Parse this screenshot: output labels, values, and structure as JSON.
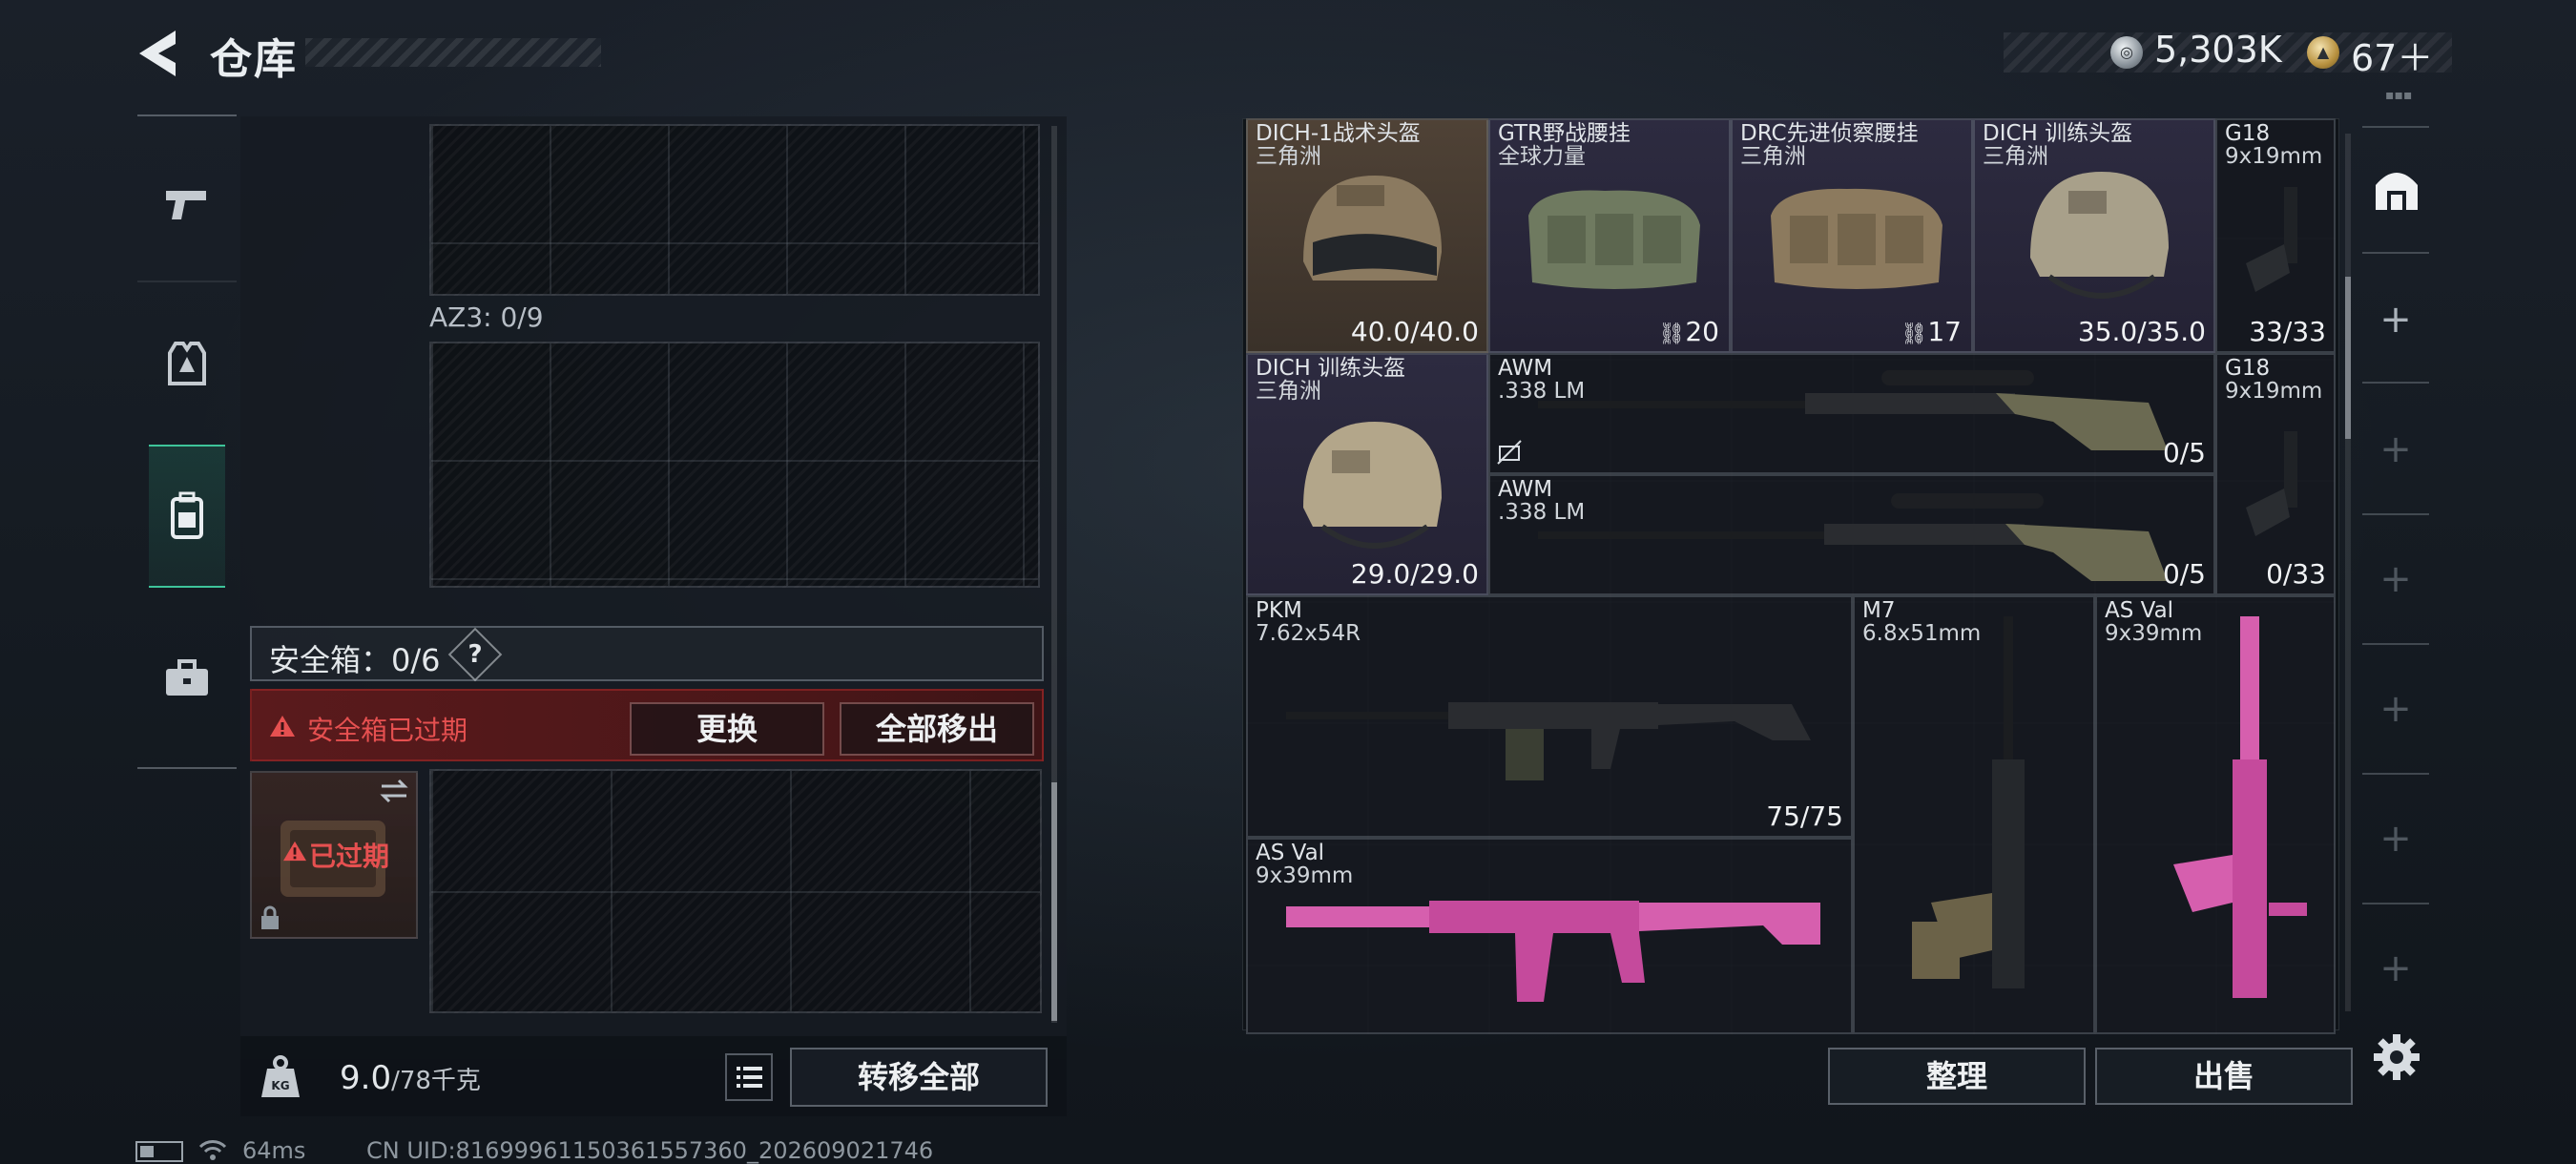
{
  "header": {
    "title": "仓库",
    "silver_value": "5,303K",
    "gold_value": "67＋",
    "corner_mark": "▪▪▪"
  },
  "left_nav": {
    "tabs": [
      {
        "name": "weapons",
        "icon": "pistol-icon"
      },
      {
        "name": "equipment",
        "icon": "vest-icon"
      },
      {
        "name": "backpack",
        "icon": "backpack-icon",
        "active": true
      },
      {
        "name": "briefcase",
        "icon": "briefcase-icon"
      }
    ]
  },
  "left_panel": {
    "az3_label": "AZ3: 0/9",
    "safe_box_label": "安全箱：0/6",
    "safe_help": "?",
    "expired_message": "安全箱已过期",
    "replace_button": "更换",
    "move_all_out_button": "全部移出",
    "case_expired": "已过期"
  },
  "weight": {
    "current": "9.0",
    "max": "/78千克",
    "transfer_all_button": "转移全部"
  },
  "status": {
    "ping": "64ms",
    "uid": "CN UID:8169996115036155736​0_202609021746"
  },
  "warehouse": {
    "items": [
      {
        "name": "DICH-1战术头盔",
        "sub": "三角洲",
        "value": "40.0/40.0"
      },
      {
        "name": "GTR野战腰挂",
        "sub": "全球力量",
        "value": "20"
      },
      {
        "name": "DRC先进侦察腰挂",
        "sub": "三角洲",
        "value": "17"
      },
      {
        "name": "DICH 训练头盔",
        "sub": "三角洲",
        "value": "35.0/35.0"
      },
      {
        "name": "G18",
        "sub": "9x19mm",
        "value": "33/33"
      },
      {
        "name": "DICH 训练头盔",
        "sub": "三角洲",
        "value": "29.0/29.0"
      },
      {
        "name": "AWM",
        "sub": ".338 LM",
        "value": "0/5"
      },
      {
        "name": "AWM",
        "sub": ".338 LM",
        "value": "0/5"
      },
      {
        "name": "G18",
        "sub": "9x19mm",
        "value": "0/33"
      },
      {
        "name": "PKM",
        "sub": "7.62x54R",
        "value": "75/75"
      },
      {
        "name": "M7",
        "sub": "6.8x51mm",
        "value": ""
      },
      {
        "name": "AS Val",
        "sub": "9x39mm",
        "value": ""
      },
      {
        "name": "AS Val",
        "sub": "9x39mm",
        "value": ""
      }
    ],
    "sort_button": "整理",
    "sell_button": "出售"
  }
}
